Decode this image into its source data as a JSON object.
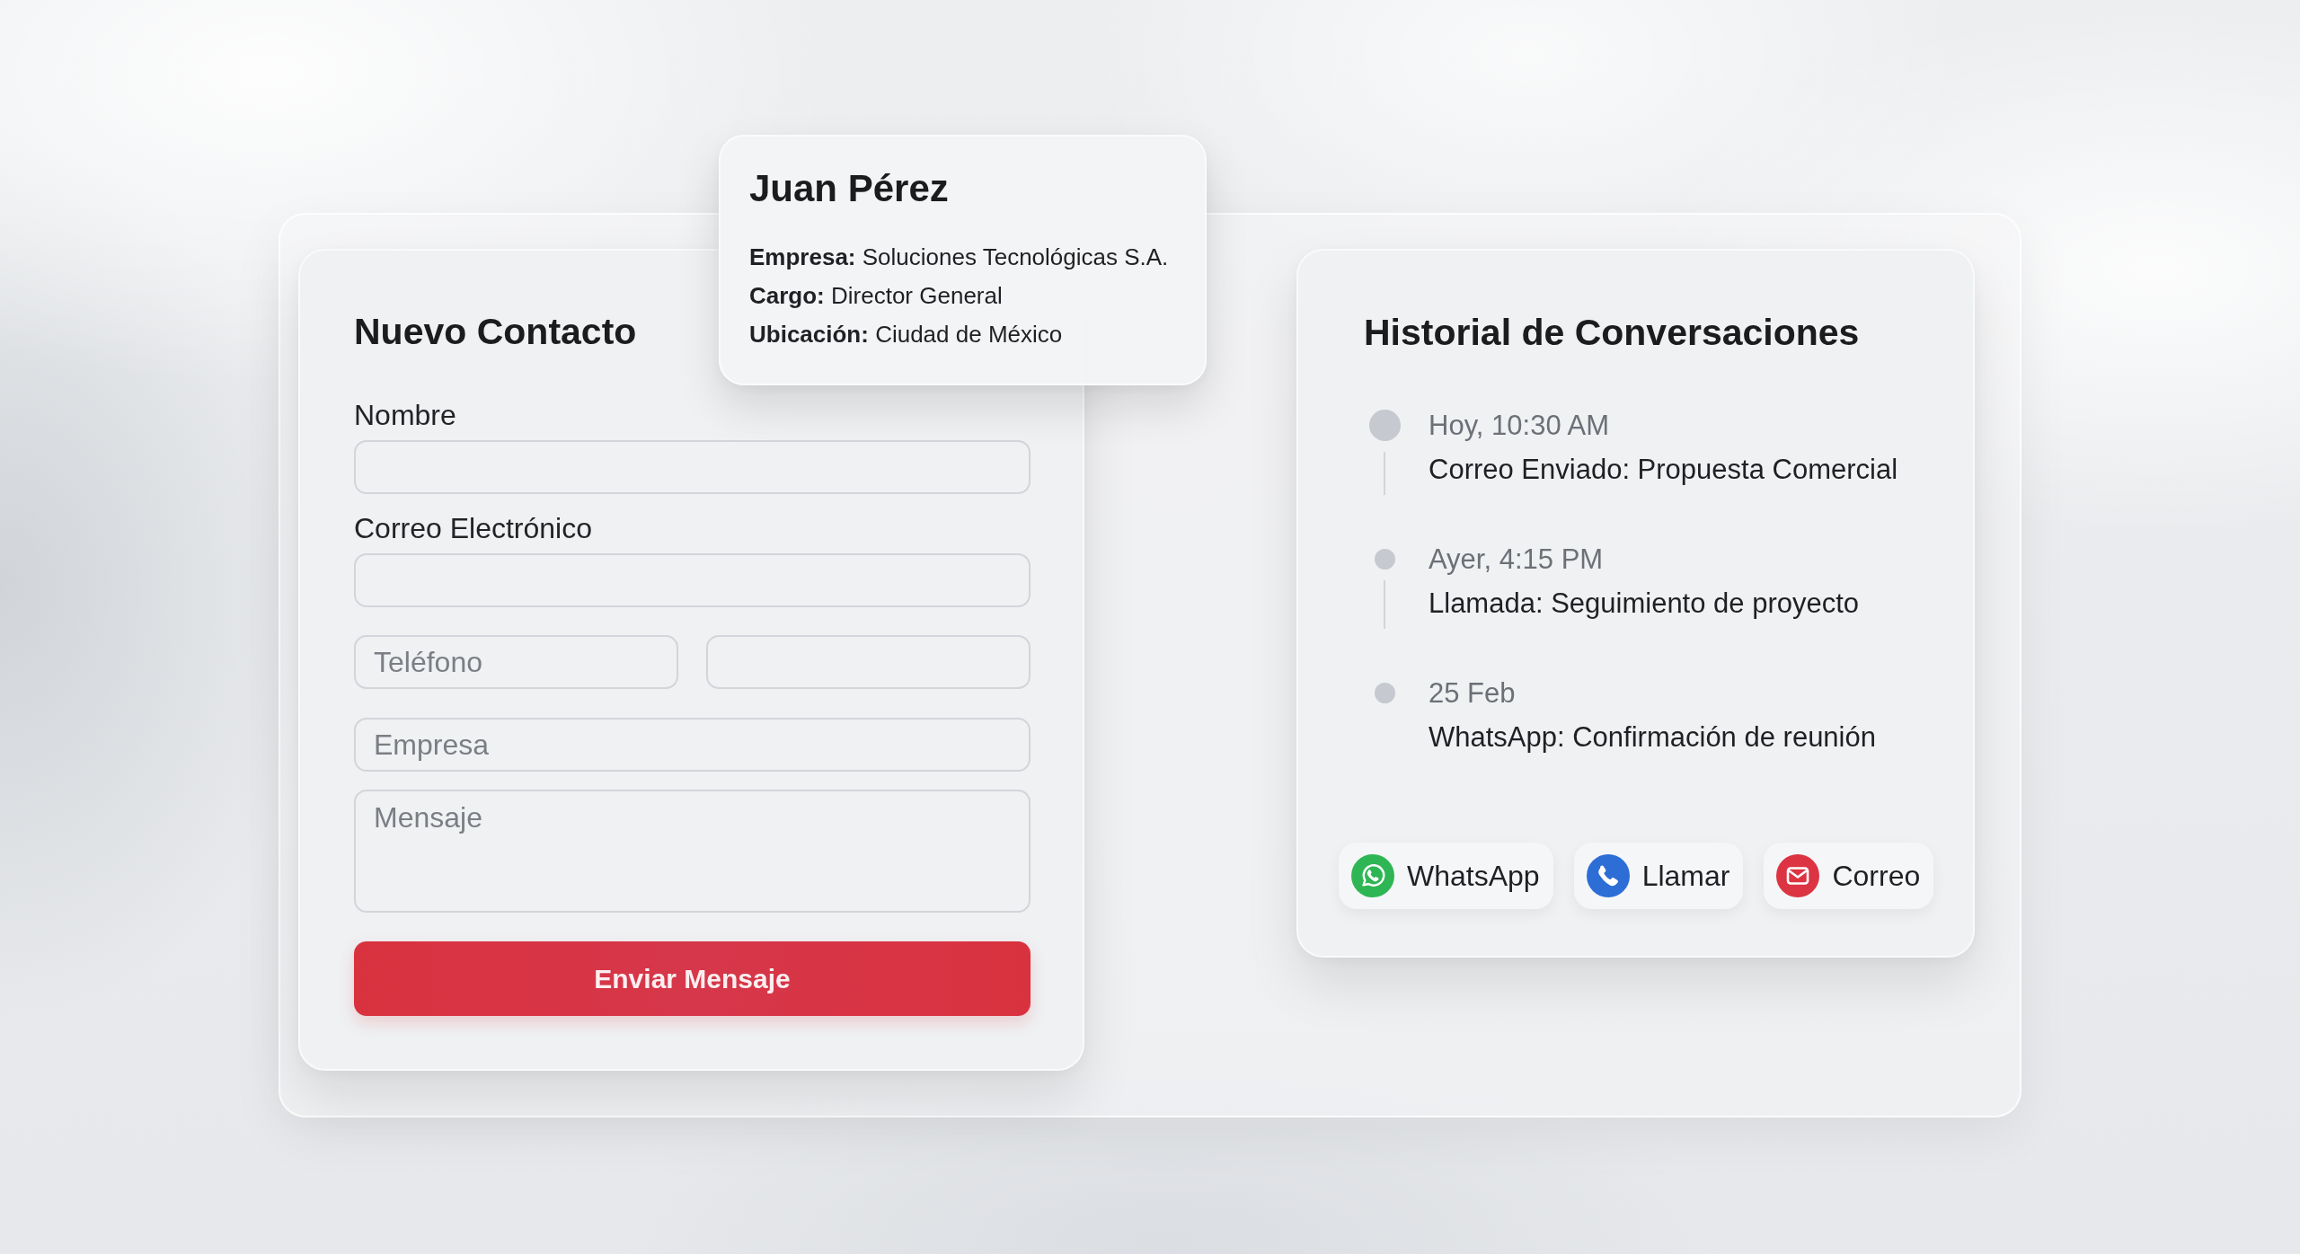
{
  "contact_card": {
    "name": "Juan Pérez",
    "details": [
      "**Empresa:** Soluciones Tecnológicas S.A.",
      "**Cargo:** Director General",
      "**Ubicación:** Ciudad de México"
    ]
  },
  "contact_form": {
    "title": "Nuevo Contacto",
    "fields": [
      {
        "kind": "labeled",
        "label": "Nombre"
      },
      {
        "kind": "labeled",
        "label": "Correo Electrónico"
      },
      {
        "kind": "split",
        "placeholder": "Teléfono"
      },
      {
        "kind": "single",
        "placeholder": "Empresa"
      },
      {
        "kind": "multiline",
        "placeholder": "Mensaje"
      }
    ],
    "submit_button": "Enviar Mensaje"
  },
  "history": {
    "title": "Historial de Conversaciones",
    "entries": [
      {
        "time": "Hoy, 10:30 AM",
        "summary": "Correo Enviado: Propuesta Comercial",
        "current": true
      },
      {
        "time": "Ayer, 4:15 PM",
        "summary": "Llamada: Seguimiento de proyecto",
        "current": false
      },
      {
        "time": "25 Feb",
        "summary": "WhatsApp: Confirmación de reunión",
        "current": false
      }
    ],
    "actions": [
      {
        "kind": "whatsapp",
        "label": "WhatsApp"
      },
      {
        "kind": "call",
        "label": "Llamar"
      },
      {
        "kind": "email",
        "label": "Correo"
      }
    ]
  }
}
